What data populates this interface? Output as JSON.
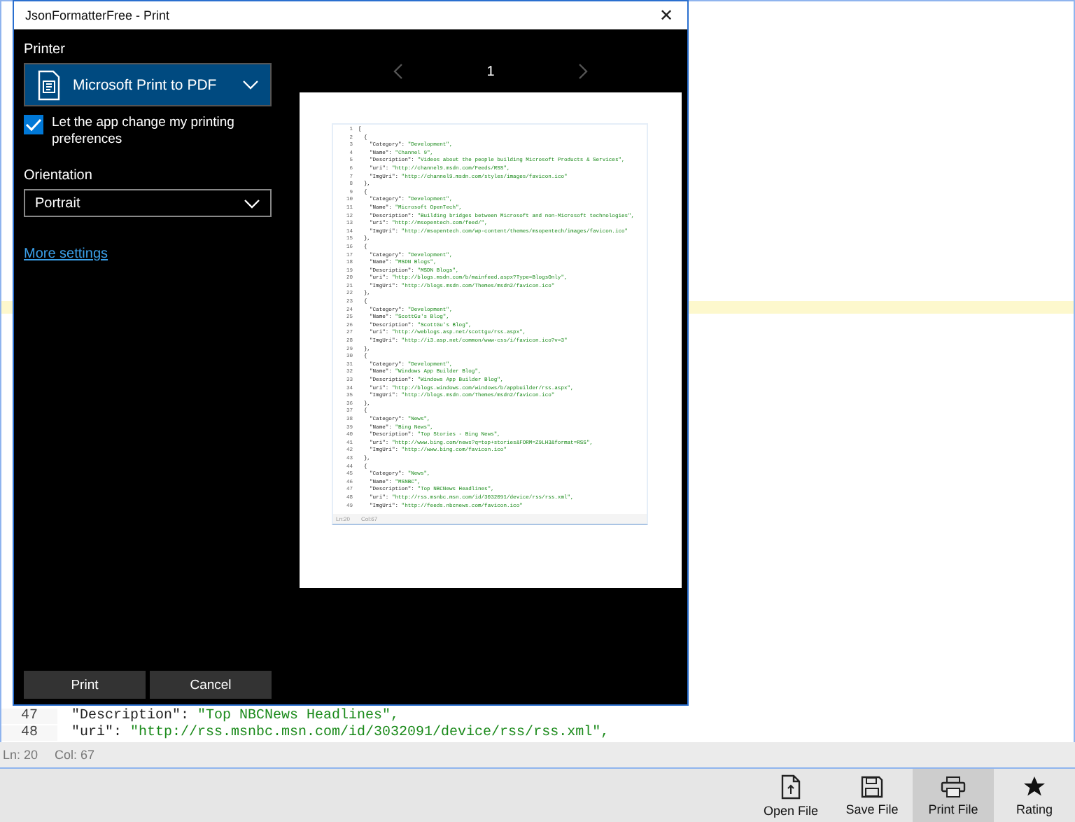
{
  "dialog": {
    "title": "JsonFormatterFree - Print",
    "close": "✕",
    "printer_label": "Printer",
    "printer": "Microsoft Print to PDF",
    "let_app_change": {
      "label": "Let the app change my printing preferences",
      "checked": true
    },
    "orientation_label": "Orientation",
    "orientation": "Portrait",
    "more_settings": "More settings",
    "page_number": "1",
    "buttons": [
      "Print",
      "Cancel"
    ],
    "preview": {
      "lines": [
        {
          "num": "1",
          "kind": "bracket",
          "value": "["
        },
        {
          "num": "2",
          "kind": "brace",
          "value": "{"
        },
        {
          "num": "3",
          "kind": "pair",
          "key": "\"Category\": ",
          "value": "\"Development\","
        },
        {
          "num": "4",
          "kind": "pair",
          "key": "\"Name\": ",
          "value": "\"Channel 9\","
        },
        {
          "num": "5",
          "kind": "pair",
          "key": "\"Description\": ",
          "value": "\"Videos about the people building Microsoft Products & Services\","
        },
        {
          "num": "6",
          "kind": "pair",
          "key": "\"uri\": ",
          "value": "\"http://channel9.msdn.com/Feeds/RSS\","
        },
        {
          "num": "7",
          "kind": "pair",
          "key": "\"ImgUri\": ",
          "value": "\"http://channel9.msdn.com/styles/images/favicon.ico\""
        },
        {
          "num": "8",
          "kind": "brace",
          "value": "},"
        },
        {
          "num": "9",
          "kind": "brace",
          "value": "{"
        },
        {
          "num": "10",
          "kind": "pair",
          "key": "\"Category\": ",
          "value": "\"Development\","
        },
        {
          "num": "11",
          "kind": "pair",
          "key": "\"Name\": ",
          "value": "\"Microsoft OpenTech\","
        },
        {
          "num": "12",
          "kind": "pair",
          "key": "\"Description\": ",
          "value": "\"Building bridges between Microsoft and non-Microsoft technologies\","
        },
        {
          "num": "13",
          "kind": "pair",
          "key": "\"uri\": ",
          "value": "\"http://msopentech.com/feed/\","
        },
        {
          "num": "14",
          "kind": "pair",
          "key": "\"ImgUri\": ",
          "value": "\"http://msopentech.com/wp-content/themes/msopentech/images/favicon.ico\""
        },
        {
          "num": "15",
          "kind": "brace",
          "value": "},"
        },
        {
          "num": "16",
          "kind": "brace",
          "value": "{"
        },
        {
          "num": "17",
          "kind": "pair",
          "key": "\"Category\": ",
          "value": "\"Development\","
        },
        {
          "num": "18",
          "kind": "pair",
          "key": "\"Name\": ",
          "value": "\"MSDN Blogs\","
        },
        {
          "num": "19",
          "kind": "pair",
          "key": "\"Description\": ",
          "value": "\"MSDN Blogs\","
        },
        {
          "num": "20",
          "kind": "pair",
          "key": "\"uri\": ",
          "value": "\"http://blogs.msdn.com/b/mainfeed.aspx?Type=BlogsOnly\","
        },
        {
          "num": "21",
          "kind": "pair",
          "key": "\"ImgUri\": ",
          "value": "\"http://blogs.msdn.com/Themes/msdn2/favicon.ico\""
        },
        {
          "num": "22",
          "kind": "brace",
          "value": "},"
        },
        {
          "num": "23",
          "kind": "brace",
          "value": "{"
        },
        {
          "num": "24",
          "kind": "pair",
          "key": "\"Category\": ",
          "value": "\"Development\","
        },
        {
          "num": "25",
          "kind": "pair",
          "key": "\"Name\": ",
          "value": "\"ScottGu's Blog\","
        },
        {
          "num": "26",
          "kind": "pair",
          "key": "\"Description\": ",
          "value": "\"ScottGu's Blog\","
        },
        {
          "num": "27",
          "kind": "pair",
          "key": "\"uri\": ",
          "value": "\"http://weblogs.asp.net/scottgu/rss.aspx\","
        },
        {
          "num": "28",
          "kind": "pair",
          "key": "\"ImgUri\": ",
          "value": "\"http://i3.asp.net/common/www-css/i/favicon.ico?v=3\""
        },
        {
          "num": "29",
          "kind": "brace",
          "value": "},"
        },
        {
          "num": "30",
          "kind": "brace",
          "value": "{"
        },
        {
          "num": "31",
          "kind": "pair",
          "key": "\"Category\": ",
          "value": "\"Development\","
        },
        {
          "num": "32",
          "kind": "pair",
          "key": "\"Name\": ",
          "value": "\"Windows App Builder Blog\","
        },
        {
          "num": "33",
          "kind": "pair",
          "key": "\"Description\": ",
          "value": "\"Windows App Builder Blog\","
        },
        {
          "num": "34",
          "kind": "pair",
          "key": "\"uri\": ",
          "value": "\"http://blogs.windows.com/windows/b/appbuilder/rss.aspx\","
        },
        {
          "num": "35",
          "kind": "pair",
          "key": "\"ImgUri\": ",
          "value": "\"http://blogs.msdn.com/Themes/msdn2/favicon.ico\""
        },
        {
          "num": "36",
          "kind": "brace",
          "value": "},"
        },
        {
          "num": "37",
          "kind": "brace",
          "value": "{"
        },
        {
          "num": "38",
          "kind": "pair",
          "key": "\"Category\": ",
          "value": "\"News\","
        },
        {
          "num": "39",
          "kind": "pair",
          "key": "\"Name\": ",
          "value": "\"Bing News\","
        },
        {
          "num": "40",
          "kind": "pair",
          "key": "\"Description\": ",
          "value": "\"Top Stories - Bing News\","
        },
        {
          "num": "41",
          "kind": "pair",
          "key": "\"uri\": ",
          "value": "\"http://www.bing.com/news?q=top+stories&FORM=Z9LH3&format=RSS\","
        },
        {
          "num": "42",
          "kind": "pair",
          "key": "\"ImgUri\": ",
          "value": "\"http://www.bing.com/favicon.ico\""
        },
        {
          "num": "43",
          "kind": "brace",
          "value": "},"
        },
        {
          "num": "44",
          "kind": "brace",
          "value": "{"
        },
        {
          "num": "45",
          "kind": "pair",
          "key": "\"Category\": ",
          "value": "\"News\","
        },
        {
          "num": "46",
          "kind": "pair",
          "key": "\"Name\": ",
          "value": "\"MSNBC\","
        },
        {
          "num": "47",
          "kind": "pair",
          "key": "\"Description\": ",
          "value": "\"Top NBCNews Headlines\","
        },
        {
          "num": "48",
          "kind": "pair",
          "key": "\"uri\": ",
          "value": "\"http://rss.msnbc.msn.com/id/3032091/device/rss/rss.xml\","
        },
        {
          "num": "49",
          "kind": "pair",
          "key": "\"ImgUri\": ",
          "value": "\"http://feeds.nbcnews.com/favicon.ico\""
        }
      ],
      "status": [
        "Ln:20",
        "Col:67"
      ]
    }
  },
  "editor": {
    "lines": [
      {
        "num": "47",
        "key": "\"Description\": ",
        "value": "\"Top NBCNews Headlines\","
      },
      {
        "num": "48",
        "key": "\"uri\": ",
        "value": "\"http://rss.msnbc.msn.com/id/3032091/device/rss/rss.xml\","
      }
    ]
  },
  "status_bar": [
    "Ln: 20",
    "Col: 67"
  ],
  "toolbar": [
    {
      "kind": "open",
      "label": "Open File",
      "selected": false
    },
    {
      "kind": "save",
      "label": "Save File",
      "selected": false
    },
    {
      "kind": "print",
      "label": "Print File",
      "selected": true
    },
    {
      "kind": "rating",
      "label": "Rating",
      "selected": false
    }
  ]
}
